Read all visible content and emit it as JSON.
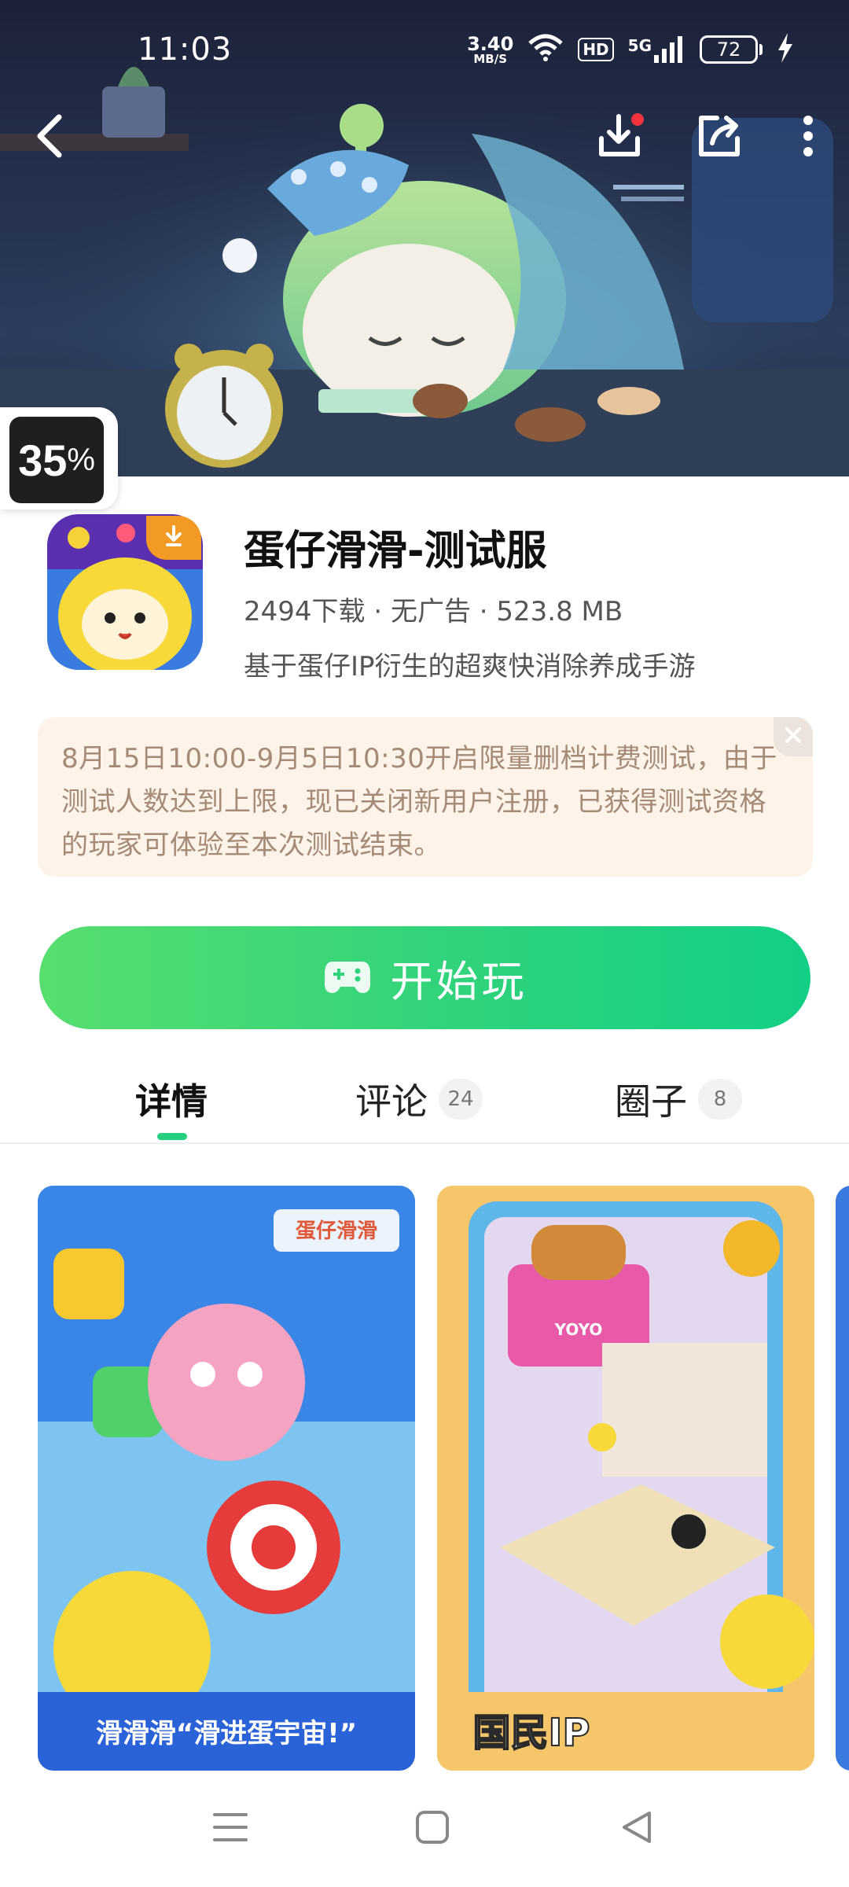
{
  "status_bar": {
    "time": "11:03",
    "net_speed_value": "3.40",
    "net_speed_unit": "MB/S",
    "hd_label": "HD",
    "network_type": "5G",
    "battery_level": "72",
    "icons": [
      "wifi-icon",
      "signal-icon",
      "charging-icon"
    ]
  },
  "top_bar": {
    "icons": [
      "back-icon",
      "download-icon",
      "share-icon",
      "more-icon"
    ],
    "download_dot_color": "#f5333f"
  },
  "hero": {
    "progress_number": "35",
    "progress_unit": "%"
  },
  "app": {
    "name": "蛋仔滑滑-测试服",
    "meta": "2494下载 · 无广告 · 523.8 MB",
    "description": "基于蛋仔IP衍生的超爽快消除养成手游"
  },
  "notice": {
    "text": "8月15日10:00-9月5日10:30开启限量删档计费测试，由于测试人数达到上限，现已关闭新用户注册，已获得测试资格的玩家可体验至本次测试结束。"
  },
  "play_button": {
    "label": "开始玩",
    "color_start": "#57de6f",
    "color_end": "#12cf85"
  },
  "tabs": [
    {
      "label": "详情",
      "count": "",
      "active": true
    },
    {
      "label": "评论",
      "count": "24",
      "active": false
    },
    {
      "label": "圈子",
      "count": "8",
      "active": false
    }
  ],
  "screenshots": [
    {
      "title_small": "蛋仔滑滑",
      "banner": "滑滑滑“滑进蛋宇宙!”"
    },
    {
      "sign": "YOYO",
      "banner": "国民IP"
    }
  ],
  "nav_bar": {
    "icons": [
      "menu-icon",
      "home-icon",
      "back-triangle-icon"
    ]
  },
  "colors": {
    "accent_green": "#25d07f",
    "notice_bg": "#fdf3e8",
    "notice_text": "#a48a78",
    "badge_orange": "#f39a24"
  }
}
